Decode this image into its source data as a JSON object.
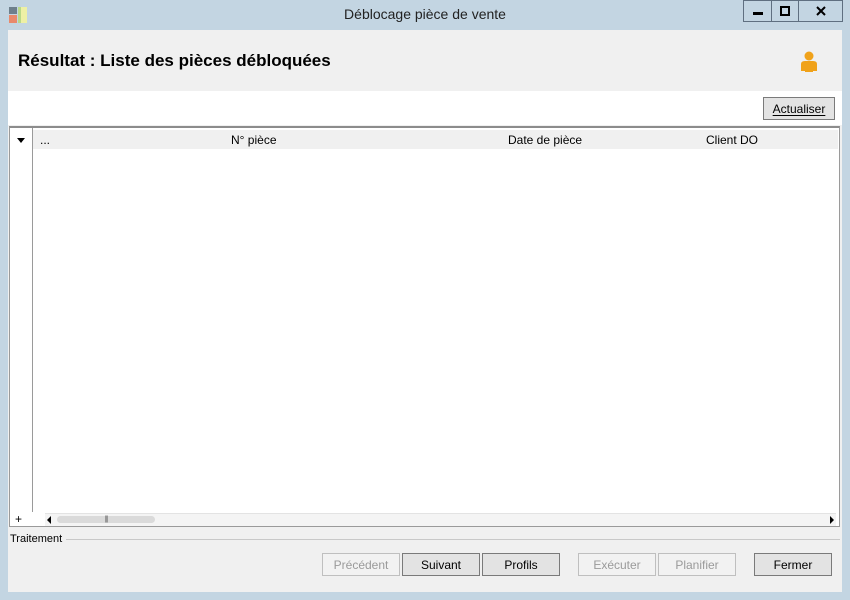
{
  "window": {
    "title": "Déblocage pièce de vente",
    "minimize_glyph": "▬",
    "maximize_glyph": "□",
    "close_glyph": "x"
  },
  "header": {
    "title": "Résultat : Liste des pièces débloquées",
    "user_icon": "user-icon"
  },
  "toolbar": {
    "refresh_label": "Actualiser"
  },
  "grid": {
    "columns": [
      "...",
      "N° pièce",
      "Date de pièce",
      "Client DO"
    ],
    "rows": [],
    "add_glyph": "+",
    "scroll_thumb_glyph": "|||"
  },
  "footer": {
    "group_label": "Traitement",
    "buttons": {
      "previous": "Précédent",
      "next": "Suivant",
      "profiles": "Profils",
      "execute": "Exécuter",
      "schedule": "Planifier",
      "close": "Fermer"
    }
  },
  "colors": {
    "frame": "#c3d5e2",
    "client_bg": "#f0f0f0",
    "user_icon": "#f0a21a"
  }
}
